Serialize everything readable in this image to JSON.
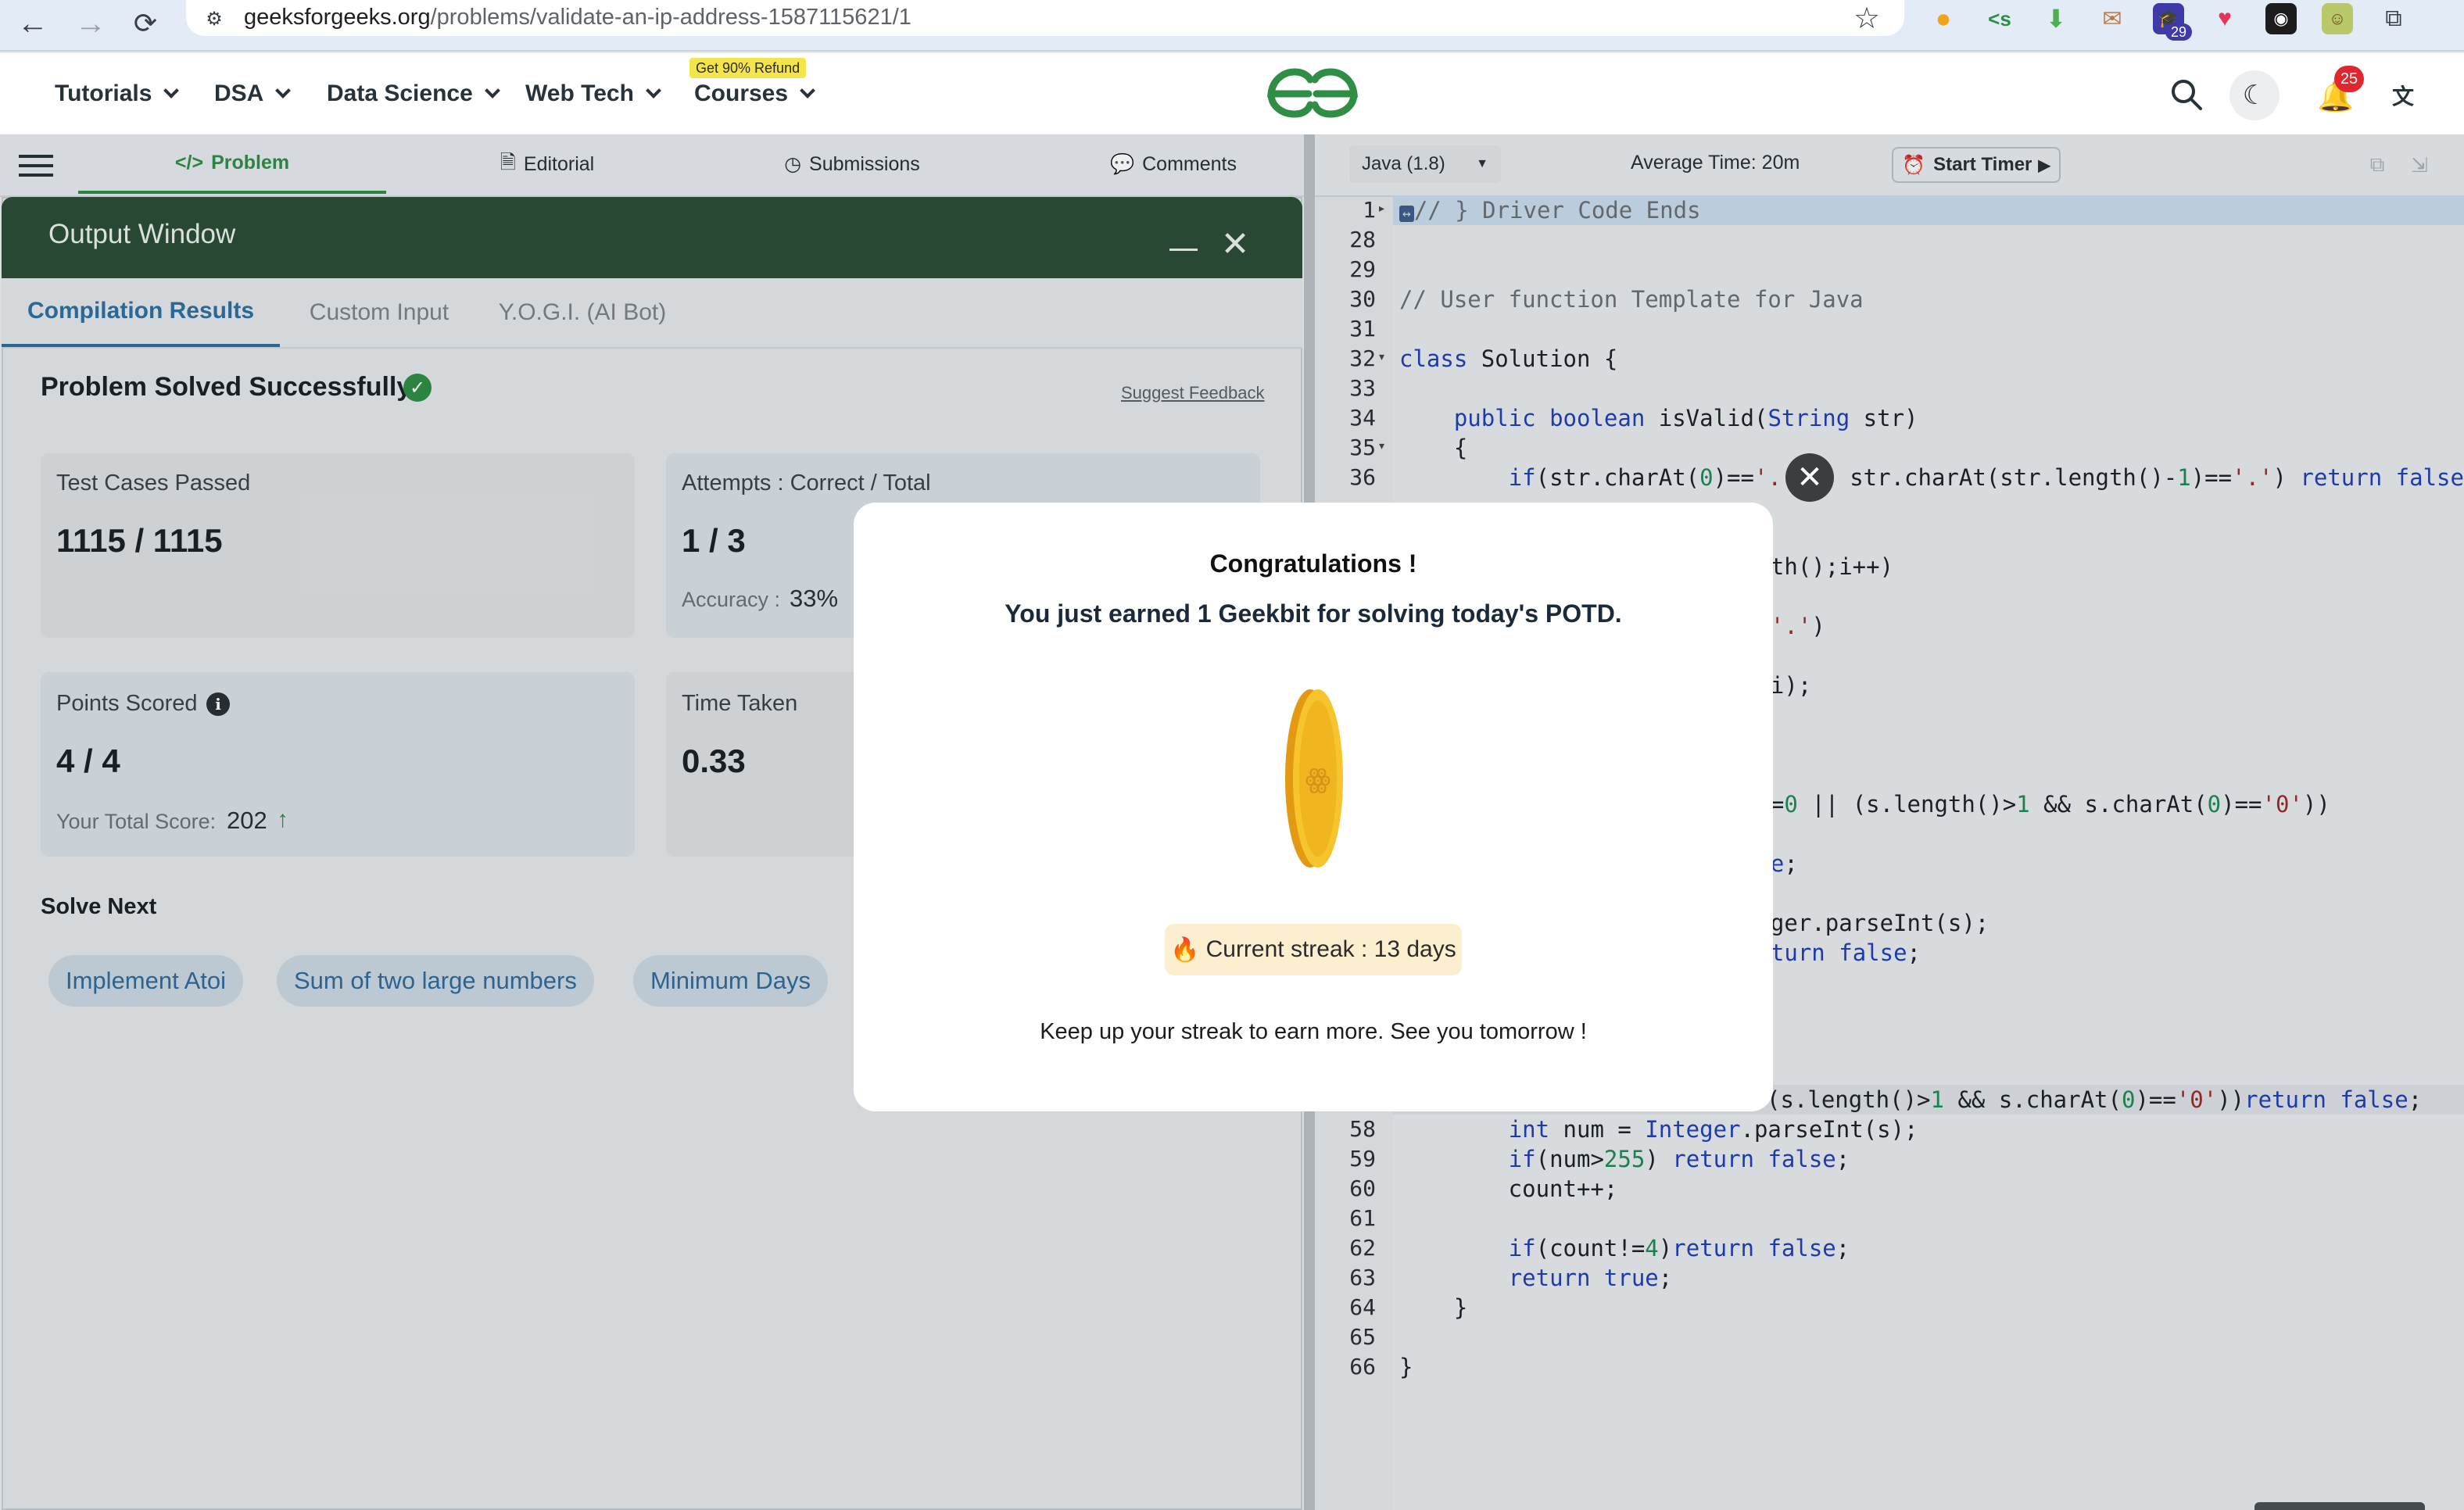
{
  "browser": {
    "url_host": "geeksforgeeks.org",
    "url_path": "/problems/validate-an-ip-address-1587115621/1",
    "ext_badge": "29"
  },
  "header": {
    "menus": [
      "Tutorials",
      "DSA",
      "Data Science",
      "Web Tech",
      "Courses"
    ],
    "courses_badge": "Get 90% Refund",
    "notif_count": "25"
  },
  "left_tabs": [
    "Problem",
    "Editorial",
    "Submissions",
    "Comments"
  ],
  "output_window": {
    "title": "Output Window",
    "tabs": [
      "Compilation Results",
      "Custom Input",
      "Y.O.G.I. (AI Bot)"
    ],
    "status": "Problem Solved Successfully",
    "feedback": "Suggest Feedback",
    "cards": {
      "tests_label": "Test Cases Passed",
      "tests_value": "1115 / 1115",
      "attempts_label": "Attempts : Correct / Total",
      "attempts_value": "1 / 3",
      "accuracy_label": "Accuracy :",
      "accuracy_value": "33%",
      "points_label": "Points Scored",
      "points_value": "4 / 4",
      "total_label": "Your Total Score:",
      "total_value": "202",
      "time_label": "Time Taken",
      "time_value": "0.33"
    },
    "solve_next": "Solve Next",
    "next_problems": [
      "Implement Atoi",
      "Sum of two large numbers",
      "Minimum Days"
    ]
  },
  "editor": {
    "language": "Java (1.8)",
    "avg_time": "Average Time: 20m",
    "timer": "Start Timer"
  },
  "modal": {
    "title": "Congratulations !",
    "subtitle": "You just earned 1 Geekbit for solving today's POTD.",
    "streak": "Current streak : 13 days",
    "footer": "Keep up your streak to earn more. See you tomorrow !"
  },
  "colors": {
    "gfg_green": "#2f8d46",
    "output_header": "#2b4d37",
    "keyword": "#1f3fb8"
  }
}
